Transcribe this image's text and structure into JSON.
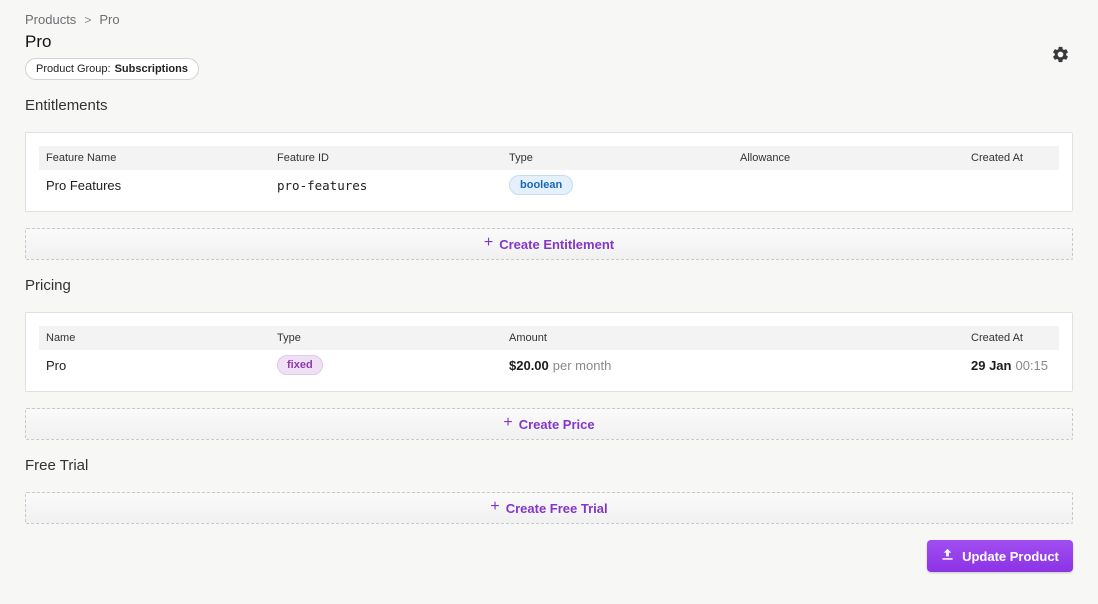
{
  "breadcrumb": {
    "root": "Products",
    "separator": ">",
    "current": "Pro"
  },
  "page": {
    "title": "Pro"
  },
  "product_group": {
    "label": "Product Group:",
    "value": "Subscriptions"
  },
  "entitlements": {
    "title": "Entitlements",
    "columns": [
      "Feature Name",
      "Feature ID",
      "Type",
      "Allowance",
      "Created At"
    ],
    "rows": [
      {
        "feature_name": "Pro Features",
        "feature_id": "pro-features",
        "type": "boolean",
        "allowance": "",
        "created_at": ""
      }
    ],
    "create_label": "Create Entitlement"
  },
  "pricing": {
    "title": "Pricing",
    "columns": [
      "Name",
      "Type",
      "Amount",
      "Created At"
    ],
    "rows": [
      {
        "name": "Pro",
        "type": "fixed",
        "amount": "$20.00",
        "period": "per month",
        "created_date": "29 Jan",
        "created_time": "00:15"
      }
    ],
    "create_label": "Create Price"
  },
  "free_trial": {
    "title": "Free Trial",
    "create_label": "Create Free Trial"
  },
  "actions": {
    "update_label": "Update Product"
  },
  "icons": {
    "settings": "gear-icon",
    "plus": "plus-icon",
    "upload": "upload-icon",
    "chevron": "chevron-right-icon"
  },
  "colors": {
    "accent": "#8c33e6",
    "accent_text": "#8436c9",
    "badge_blue": "#1a67b7",
    "badge_purple": "#8a3bad",
    "background": "#f7f7f6"
  }
}
